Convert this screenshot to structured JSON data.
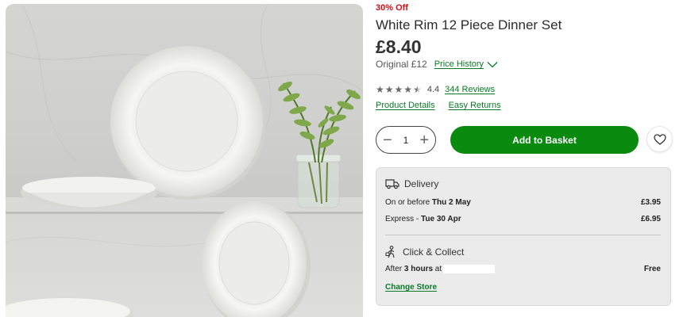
{
  "product": {
    "discount_badge": "30% Off",
    "title": "White Rim 12 Piece Dinner Set",
    "price": "£8.40",
    "original_price": "Original £12",
    "price_history_label": "Price History",
    "rating_value": "4.4",
    "rating_stars": 4.5,
    "reviews_link": "344 Reviews",
    "product_details_link": "Product Details",
    "easy_returns_link": "Easy Returns"
  },
  "purchase": {
    "quantity": "1",
    "decrement_symbol": "−",
    "increment_symbol": "+",
    "add_to_basket_label": "Add to Basket"
  },
  "delivery": {
    "heading": "Delivery",
    "options": [
      {
        "prefix": "On or before ",
        "date": "Thu 2 May",
        "cost": "£3.95"
      },
      {
        "prefix": "Express - ",
        "date": "Tue 30 Apr",
        "cost": "£6.95"
      }
    ]
  },
  "click_collect": {
    "heading": "Click & Collect",
    "prefix": "After ",
    "time": "3 hours",
    "suffix": " at",
    "cost": "Free",
    "change_store_label": "Change Store"
  },
  "colors": {
    "accent_green": "#0a8a0f",
    "link_green": "#0a7a28",
    "discount_red": "#d40f14",
    "panel_bg": "#ebebec"
  },
  "icons": [
    "chevron-down-icon",
    "star-icon",
    "minus-icon",
    "plus-icon",
    "heart-icon",
    "delivery-truck-icon",
    "click-collect-icon"
  ]
}
